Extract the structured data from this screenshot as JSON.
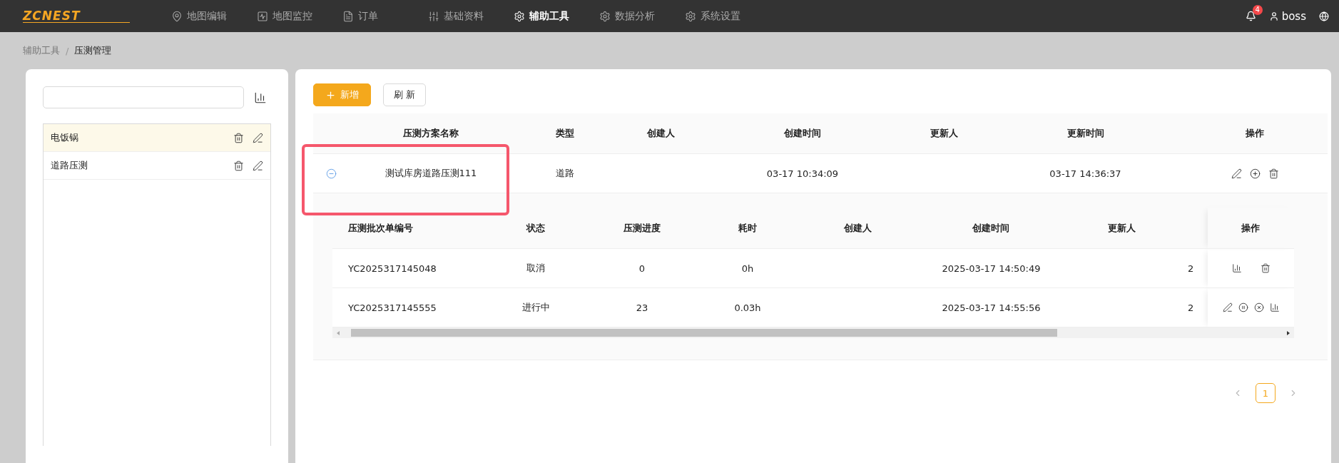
{
  "nav": {
    "logo": "ZCNEST",
    "items": [
      {
        "label": "地图编辑",
        "selected": false
      },
      {
        "label": "地图监控",
        "selected": false
      },
      {
        "label": "订单",
        "selected": false
      },
      {
        "label": "基础资料",
        "selected": false
      },
      {
        "label": "辅助工具",
        "selected": true
      },
      {
        "label": "数据分析",
        "selected": false
      },
      {
        "label": "系统设置",
        "selected": false
      }
    ],
    "notifications": "4",
    "user": "boss"
  },
  "breadcrumb": [
    "辅助工具",
    "压测管理"
  ],
  "breadcrumb_separator": "/",
  "sidebar": {
    "items": [
      {
        "label": "电饭锅",
        "selected": true
      },
      {
        "label": "道路压测",
        "selected": false
      }
    ]
  },
  "toolbar": {
    "buttons": [
      {
        "label": "新增",
        "kind": "primary"
      },
      {
        "label": "刷 新",
        "kind": "default"
      }
    ]
  },
  "table": {
    "columns": [
      "压测方案名称",
      "类型",
      "创建人",
      "创建时间",
      "更新人",
      "更新时间",
      "操作"
    ],
    "rows": [
      {
        "expanded": true,
        "name": "测试库房道路压测111",
        "type": "道路",
        "created_at": "03-17 10:34:09",
        "updated_at": "03-17 14:36:37",
        "actions": [
          {
            "kind": "edit"
          },
          {
            "kind": "add"
          },
          {
            "kind": "delete"
          }
        ]
      }
    ]
  },
  "batches": {
    "columns": [
      "压测批次单编号",
      "状态",
      "压测进度",
      "耗时",
      "创建人",
      "创建时间",
      "更新人"
    ],
    "ops_column": "操作",
    "rows": [
      {
        "batch_no": "YC2025317145048",
        "status": "取消",
        "progress": "0",
        "duration": "0h",
        "created_at": "2025-03-17 14:50:49",
        "column_8": "2",
        "actions": [
          {
            "kind": "chart"
          },
          {
            "kind": "delete"
          }
        ]
      },
      {
        "batch_no": "YC2025317145555",
        "status": "进行中",
        "progress": "23",
        "duration": "0.03h",
        "created_at": "2025-03-17 14:55:56",
        "column_8": "2",
        "actions": [
          {
            "kind": "edit"
          },
          {
            "kind": "pause"
          },
          {
            "kind": "cancel"
          },
          {
            "kind": "chart"
          }
        ]
      }
    ]
  },
  "pagination": {
    "prev_disabled": true,
    "next_disabled": true,
    "pages": [
      {
        "label": "1",
        "selected": true
      }
    ]
  },
  "annotation_box": true
}
